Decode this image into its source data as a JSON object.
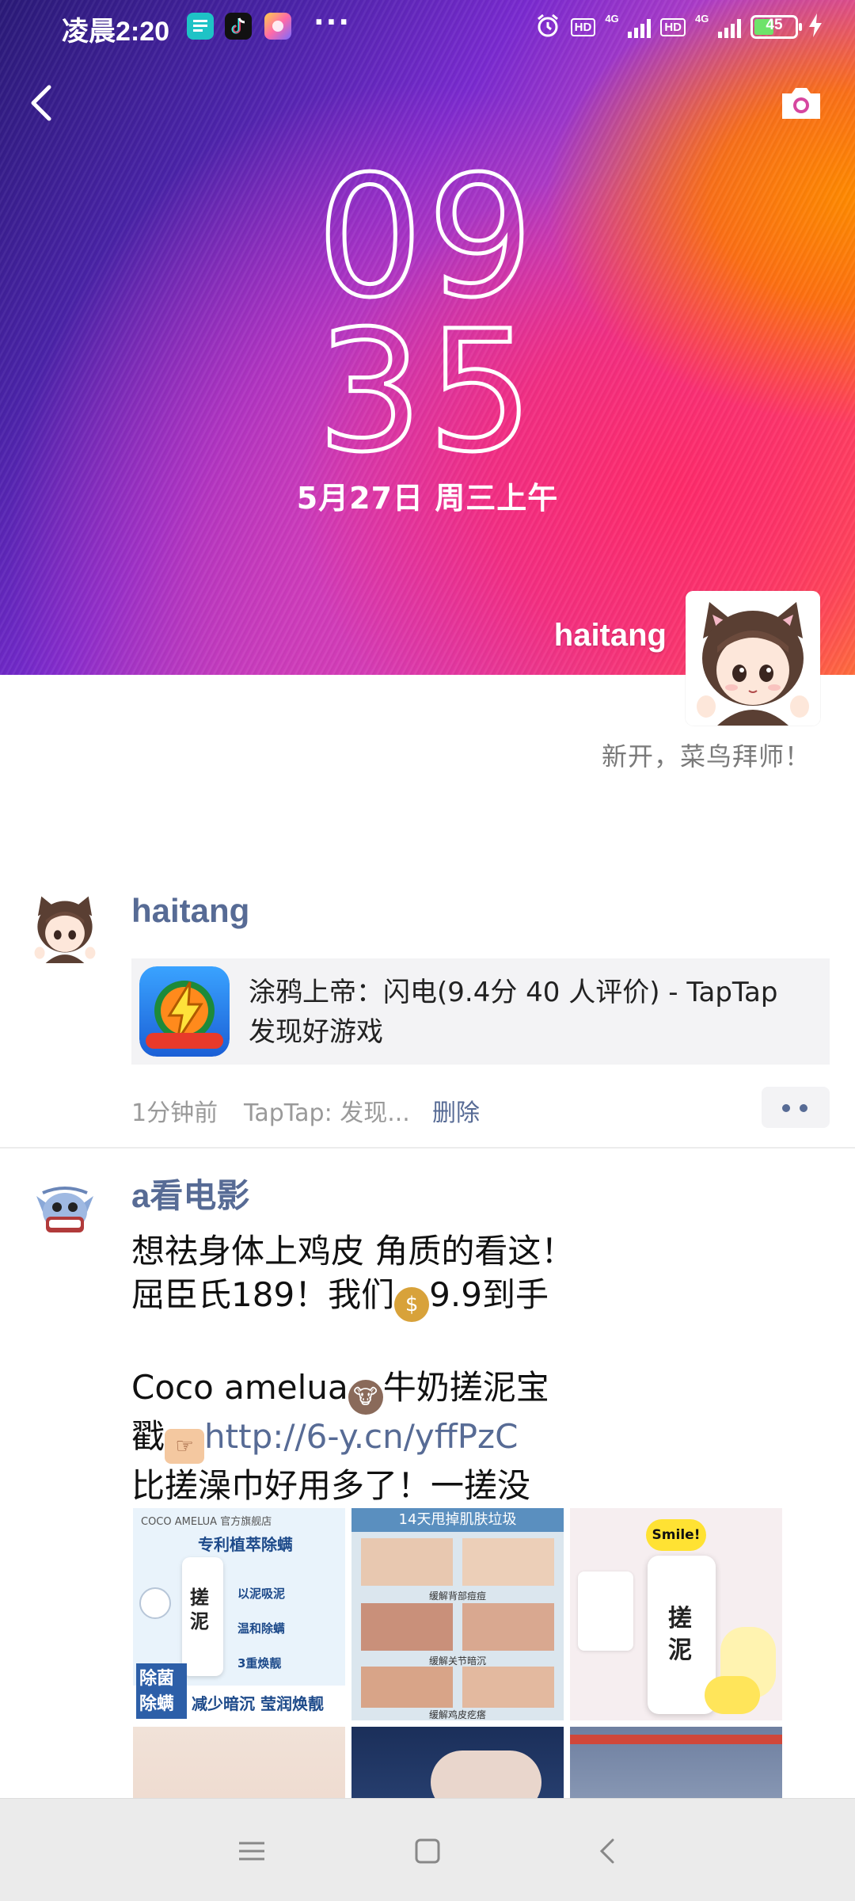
{
  "status_bar": {
    "time": "凌晨2:20",
    "more": "···",
    "hd1": "HD",
    "net1": "4G",
    "hd2": "HD",
    "net2": "4G",
    "battery": "45",
    "battery_level": 0.45
  },
  "cover": {
    "clock_hour": "09",
    "clock_minute": "35",
    "date": "5月27日 周三上午",
    "username": "haitang",
    "signature": "新开，菜鸟拜师！"
  },
  "posts": [
    {
      "author": "haitang",
      "share_title": "涂鸦上帝：闪电(9.4分 40 人评价) - TapTap 发现好游戏",
      "time": "1分钟前",
      "source": "TapTap: 发现...",
      "delete_label": "删除"
    },
    {
      "author": "a看电影",
      "line1": "想祛身体上鸡皮 角质的看这！",
      "line2_a": "屈臣氏189！我们",
      "line2_b": "9.9到手",
      "line3_a": "Coco amelua",
      "line3_b": "牛奶搓泥宝",
      "line4_a": "戳",
      "link": "http://6-y.cn/yffPzC",
      "line5": "比搓澡巾好用多了！一搓没",
      "images": [
        {
          "top_text": "COCO AMELUA 官方旗舰店",
          "title": "专利植萃除螨",
          "bottom_left": "除菌除螨",
          "bottom_text": "减少暗沉 莹润焕靓",
          "bottle_text": "搓泥",
          "badges": [
            "以泥吸泥",
            "温和除螨",
            "3重焕靓"
          ]
        },
        {
          "top_text": "14天甩掉肌肤垃圾",
          "caption1": "缓解背部痘痘",
          "caption2": "缓解关节暗沉",
          "caption3": "缓解鸡皮疙瘩"
        },
        {
          "sign_text": "Smile!",
          "bottle_text": "搓泥"
        }
      ]
    }
  ],
  "colors": {
    "link": "#576b95",
    "meta": "#9a9a9a",
    "card_bg": "#f3f3f5"
  }
}
